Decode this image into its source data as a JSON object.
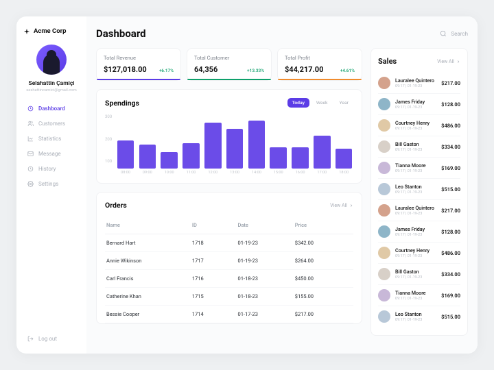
{
  "brand": "Acme Corp",
  "profile": {
    "name": "Selahattin Çamiçi",
    "email": "seshattincamici@gmail.com"
  },
  "nav": [
    {
      "label": "Dashboard",
      "active": true
    },
    {
      "label": "Customers"
    },
    {
      "label": "Statistics"
    },
    {
      "label": "Message"
    },
    {
      "label": "History"
    },
    {
      "label": "Settings"
    }
  ],
  "logout": "Log out",
  "title": "Dashboard",
  "search_placeholder": "Search",
  "stats": [
    {
      "label": "Total Revenue",
      "value": "$127,018.00",
      "delta": "+6.17%"
    },
    {
      "label": "Total Customer",
      "value": "64,356",
      "delta": "+13.33%"
    },
    {
      "label": "Total Profit",
      "value": "$44,217.00",
      "delta": "+4.61%"
    }
  ],
  "spendings": {
    "title": "Spendings",
    "segments": [
      "Today",
      "Week",
      "Year"
    ],
    "active": "Today"
  },
  "chart_data": {
    "type": "bar",
    "categories": [
      "08:00",
      "09:00",
      "10:00",
      "11:00",
      "12:00",
      "13:00",
      "14:00",
      "15:00",
      "16:00",
      "17:00",
      "18:00"
    ],
    "values": [
      170,
      145,
      100,
      155,
      280,
      240,
      290,
      130,
      130,
      200,
      120
    ],
    "xlabel": "",
    "ylabel": "",
    "ylim": [
      0,
      300
    ],
    "yticks": [
      100,
      200,
      300
    ]
  },
  "orders": {
    "title": "Orders",
    "view_all": "View All",
    "cols": [
      "Name",
      "ID",
      "Date",
      "Price"
    ],
    "rows": [
      {
        "name": "Bernard Hart",
        "id": "1718",
        "date": "01-19-23",
        "price": "$342.00"
      },
      {
        "name": "Annie Wikinson",
        "id": "1717",
        "date": "01-19-23",
        "price": "$264.00"
      },
      {
        "name": "Carl Francis",
        "id": "1716",
        "date": "01-18-23",
        "price": "$450.00"
      },
      {
        "name": "Catherine Khan",
        "id": "1715",
        "date": "01-18-23",
        "price": "$155.00"
      },
      {
        "name": "Bessie Cooper",
        "id": "1714",
        "date": "01-17-23",
        "price": "$217.00"
      }
    ]
  },
  "sales": {
    "title": "Sales",
    "view_all": "View All",
    "items": [
      {
        "name": "Lauralee Quintero",
        "date": "09:17 | 01-19-23",
        "amount": "$217.00",
        "c": "#d4a28c"
      },
      {
        "name": "James Friday",
        "date": "09:17 | 01-19-23",
        "amount": "$128.00",
        "c": "#8eb5c8"
      },
      {
        "name": "Courtney Henry",
        "date": "09:17 | 01-19-23",
        "amount": "$486.00",
        "c": "#e0c9a6"
      },
      {
        "name": "Bill Gaston",
        "date": "09:17 | 01-19-23",
        "amount": "$334.00",
        "c": "#d8d0c8"
      },
      {
        "name": "Tianna Moore",
        "date": "09:17 | 01-19-23",
        "amount": "$169.00",
        "c": "#c8b8d8"
      },
      {
        "name": "Leo Stanton",
        "date": "09:17 | 01-19-23",
        "amount": "$515.00",
        "c": "#b8c8d8"
      },
      {
        "name": "Lauralee Quintero",
        "date": "09:17 | 01-19-23",
        "amount": "$217.00",
        "c": "#d4a28c"
      },
      {
        "name": "James Friday",
        "date": "09:17 | 01-19-23",
        "amount": "$128.00",
        "c": "#8eb5c8"
      },
      {
        "name": "Courtney Henry",
        "date": "09:17 | 01-19-23",
        "amount": "$486.00",
        "c": "#e0c9a6"
      },
      {
        "name": "Bill Gaston",
        "date": "09:17 | 01-19-23",
        "amount": "$334.00",
        "c": "#d8d0c8"
      },
      {
        "name": "Tianna Moore",
        "date": "09:17 | 01-19-23",
        "amount": "$169.00",
        "c": "#c8b8d8"
      },
      {
        "name": "Leo Stanton",
        "date": "09:17 | 01-19-23",
        "amount": "$515.00",
        "c": "#b8c8d8"
      }
    ]
  }
}
